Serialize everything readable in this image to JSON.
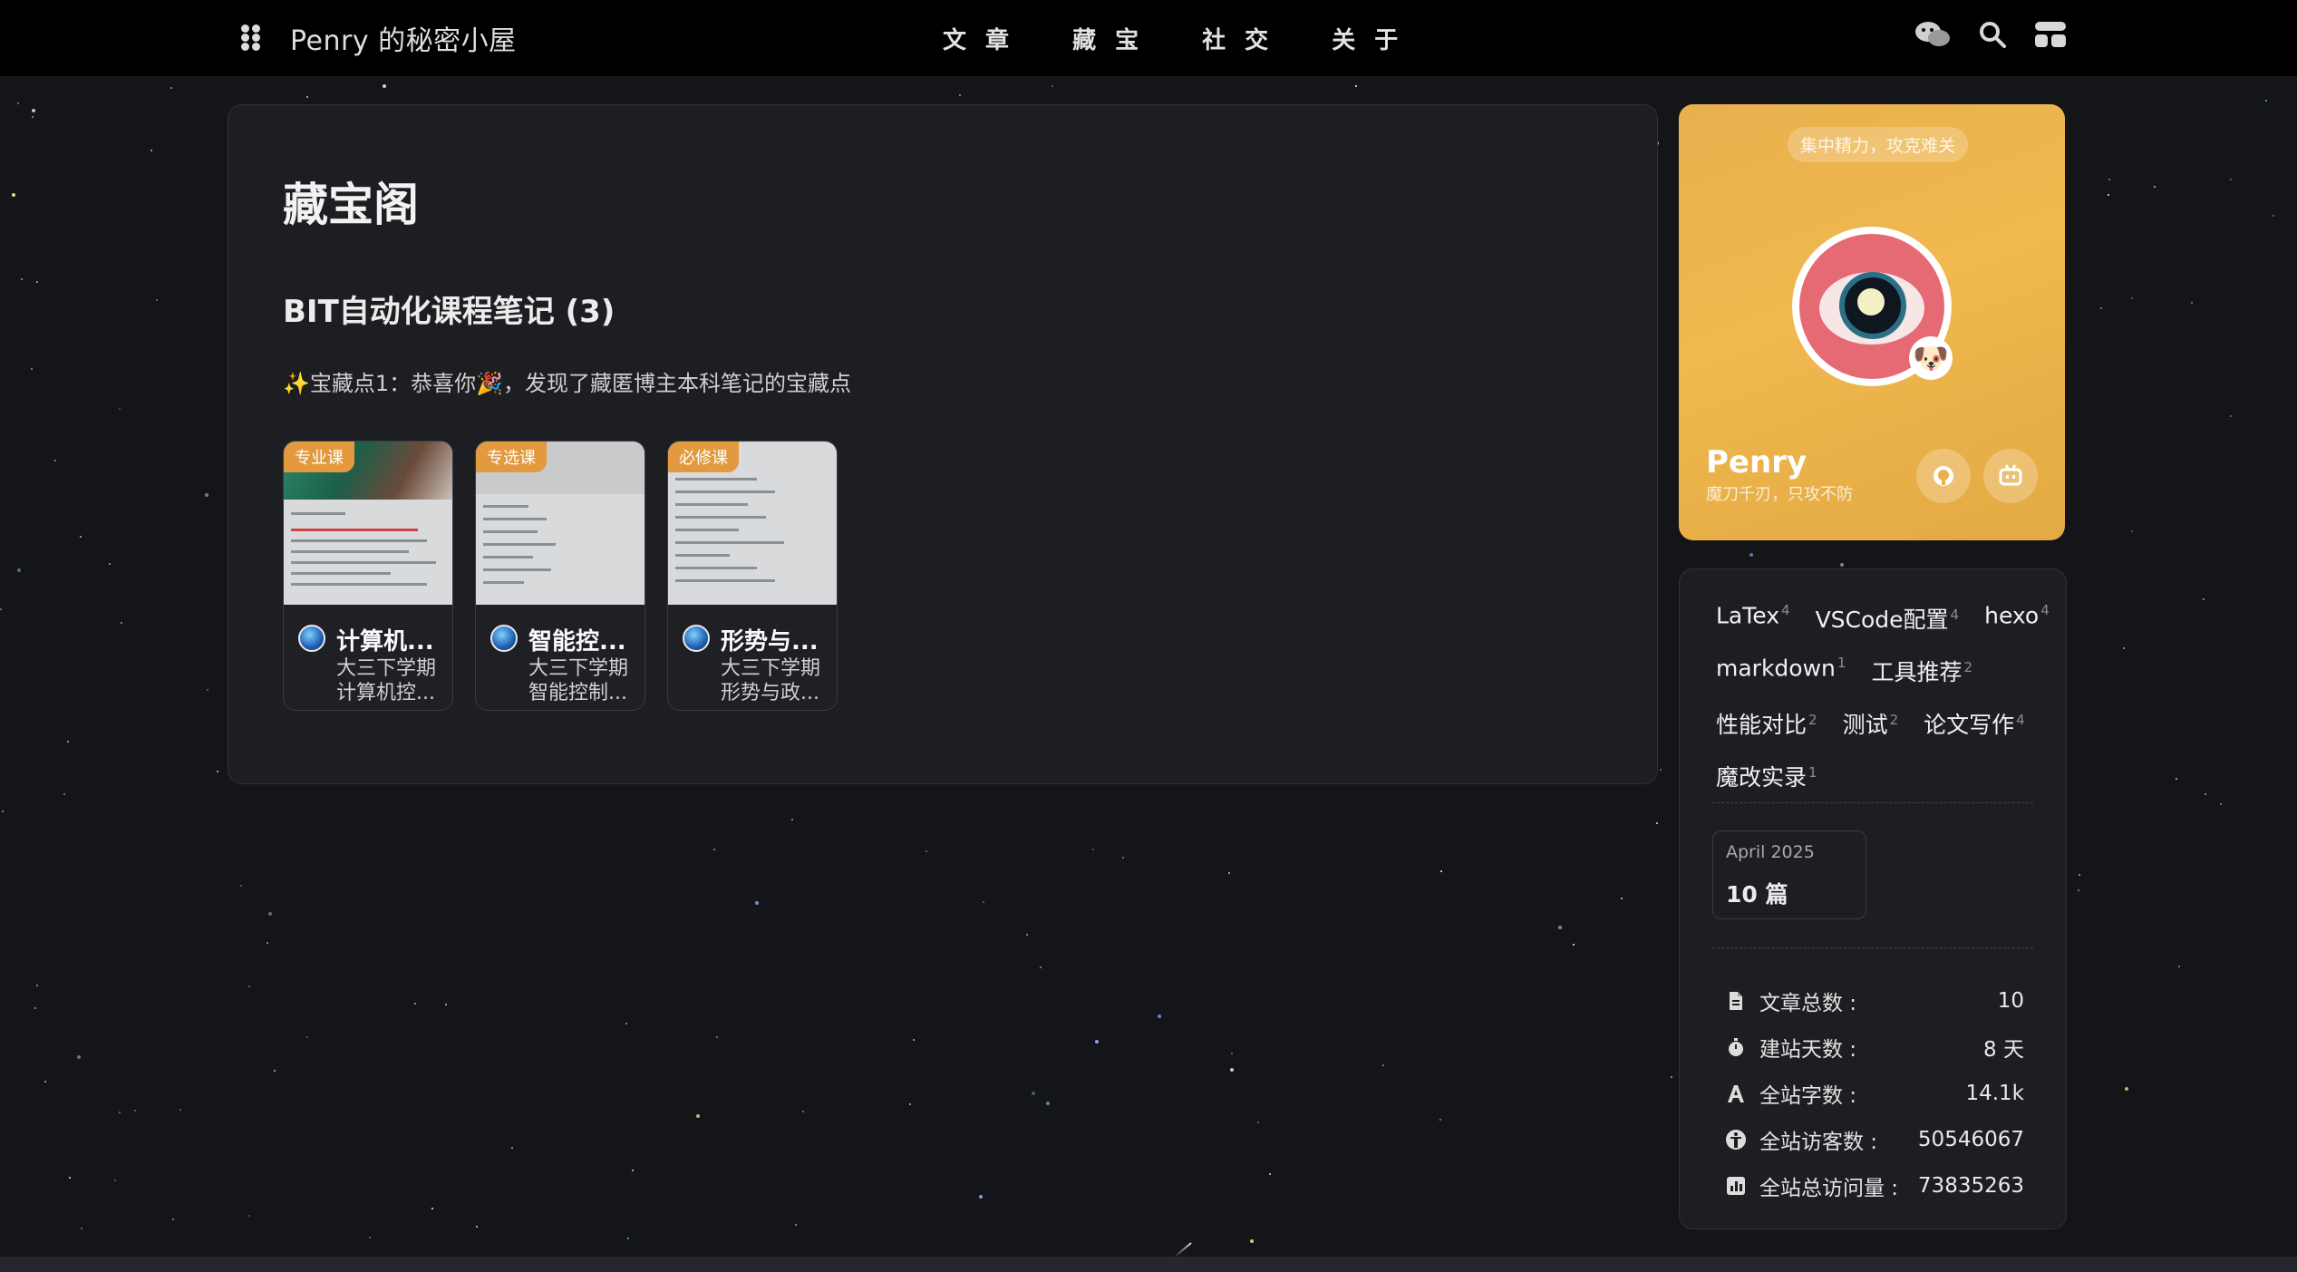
{
  "nav": {
    "brand": "Penry 的秘密小屋",
    "links": [
      "文 章",
      "藏 宝",
      "社 交",
      "关 于"
    ]
  },
  "main": {
    "title": "藏宝阁",
    "section_title": "BIT自动化课程笔记 (3)",
    "description": "✨宝藏点1：恭喜你🎉，发现了藏匿博主本科笔记的宝藏点",
    "cards": [
      {
        "badge": "专业课",
        "title": "计算机...",
        "line1": "大三下学期",
        "line2": "计算机控..."
      },
      {
        "badge": "专选课",
        "title": "智能控...",
        "line1": "大三下学期",
        "line2": "智能控制..."
      },
      {
        "badge": "必修课",
        "title": "形势与...",
        "line1": "大三下学期",
        "line2": "形势与政..."
      }
    ]
  },
  "profile": {
    "motto": "集中精力，攻克难关",
    "name": "Penry",
    "subname": "魔刀千刃，只攻不防",
    "emoji": "🐶"
  },
  "tags": [
    [
      {
        "name": "LaTex",
        "count": "4"
      },
      {
        "name": "VSCode配置",
        "count": "4"
      },
      {
        "name": "hexo",
        "count": "4"
      }
    ],
    [
      {
        "name": "markdown",
        "count": "1"
      },
      {
        "name": "工具推荐",
        "count": "2"
      }
    ],
    [
      {
        "name": "性能对比",
        "count": "2"
      },
      {
        "name": "测试",
        "count": "2"
      },
      {
        "name": "论文写作",
        "count": "4"
      }
    ],
    [
      {
        "name": "魔改实录",
        "count": "1"
      }
    ]
  ],
  "archive": {
    "month": "April 2025",
    "count": "10 篇"
  },
  "stats": [
    {
      "icon": "document-icon",
      "label": "文章总数 :",
      "value": "10"
    },
    {
      "icon": "stopwatch-icon",
      "label": "建站天数 :",
      "value": "8 天"
    },
    {
      "icon": "font-icon",
      "label": "全站字数 :",
      "value": "14.1k"
    },
    {
      "icon": "accessibility-icon",
      "label": "全站访客数 :",
      "value": "50546067"
    },
    {
      "icon": "chart-icon",
      "label": "全站总访问量 :",
      "value": "73835263"
    }
  ],
  "colors": {
    "accent": "#e3993d",
    "profile_bg": "#efb54e",
    "card_bg": "#1d1e22",
    "page_bg": "#141519"
  }
}
